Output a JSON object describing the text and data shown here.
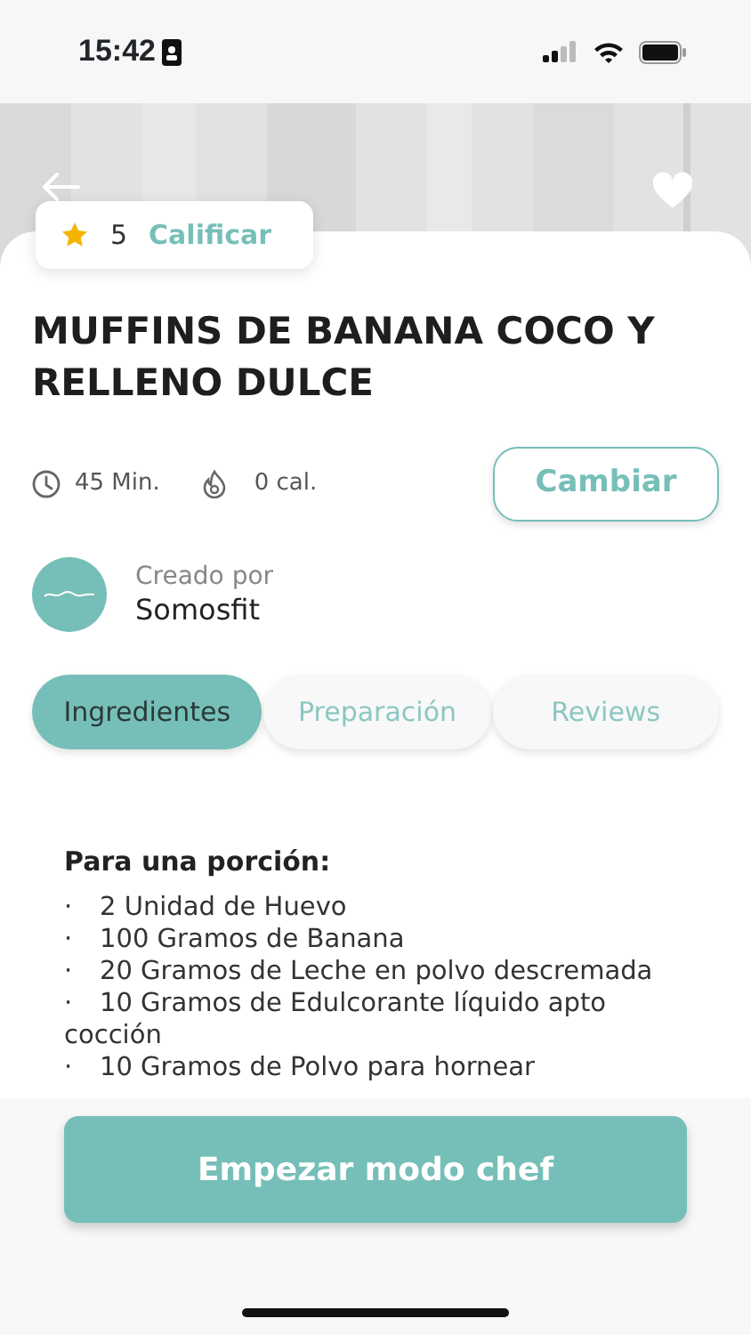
{
  "status_bar": {
    "time": "15:42"
  },
  "rating": {
    "value": "5",
    "action": "Calificar"
  },
  "recipe": {
    "title": "MUFFINS DE BANANA COCO Y RELLENO DULCE",
    "time": "45 Min.",
    "calories": "0 cal.",
    "change_button": "Cambiar"
  },
  "creator": {
    "label": "Creado por",
    "name": "Somosfit"
  },
  "tabs": [
    {
      "label": "Ingredientes",
      "selected": true
    },
    {
      "label": "Preparación",
      "selected": false
    },
    {
      "label": "Reviews",
      "selected": false
    }
  ],
  "ingredients": {
    "heading": "Para una porción:",
    "items": [
      {
        "bullet": "·",
        "text": "2 Unidad de Huevo"
      },
      {
        "bullet": "·",
        "text": "100 Gramos de Banana"
      },
      {
        "bullet": "·",
        "text": "20 Gramos de Leche en polvo descremada"
      },
      {
        "bullet": "·",
        "text": "10 Gramos de Edulcorante líquido apto cocción"
      },
      {
        "bullet": "·",
        "text": "10 Gramos de Polvo para hornear"
      }
    ]
  },
  "primary_button": "Empezar modo chef"
}
